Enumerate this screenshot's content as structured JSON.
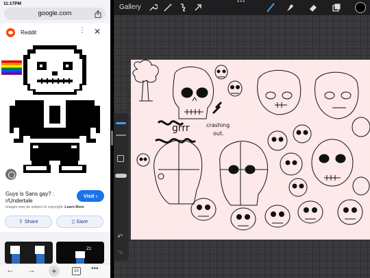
{
  "status_bar": {
    "time": "11:17PM"
  },
  "browser": {
    "url": "google.com",
    "source": "Reddit",
    "kebab": "⋮",
    "close": "✕",
    "result_title": "Guys is Sans gay? : r/Undertale",
    "visit_label": "Visit ›",
    "copyright_text": "Images may be subject to copyright.",
    "learn_more": "Learn More",
    "share_label": "Share",
    "save_label": "Save",
    "related_overlay": "Zz",
    "nav": {
      "back": "←",
      "forward": "→",
      "new_tab": "+",
      "tabs_count": "10",
      "more": "•••"
    }
  },
  "procreate": {
    "gallery_label": "Gallery",
    "menu_dots": "•••",
    "undo": "↶",
    "redo": "↷",
    "active_color": "#000000",
    "active_tool_color": "#4f9bf0",
    "canvas": {
      "background": "#fde9e9",
      "handwritten_note": "grrr",
      "handwritten_note2": "crashing",
      "handwritten_note3": "out."
    }
  },
  "colors": {
    "visit_button": "#1a73e8",
    "reddit_orange": "#ff4500",
    "toolbar_bg": "#1e1e20",
    "workspace_bg": "#3a3a3c"
  }
}
